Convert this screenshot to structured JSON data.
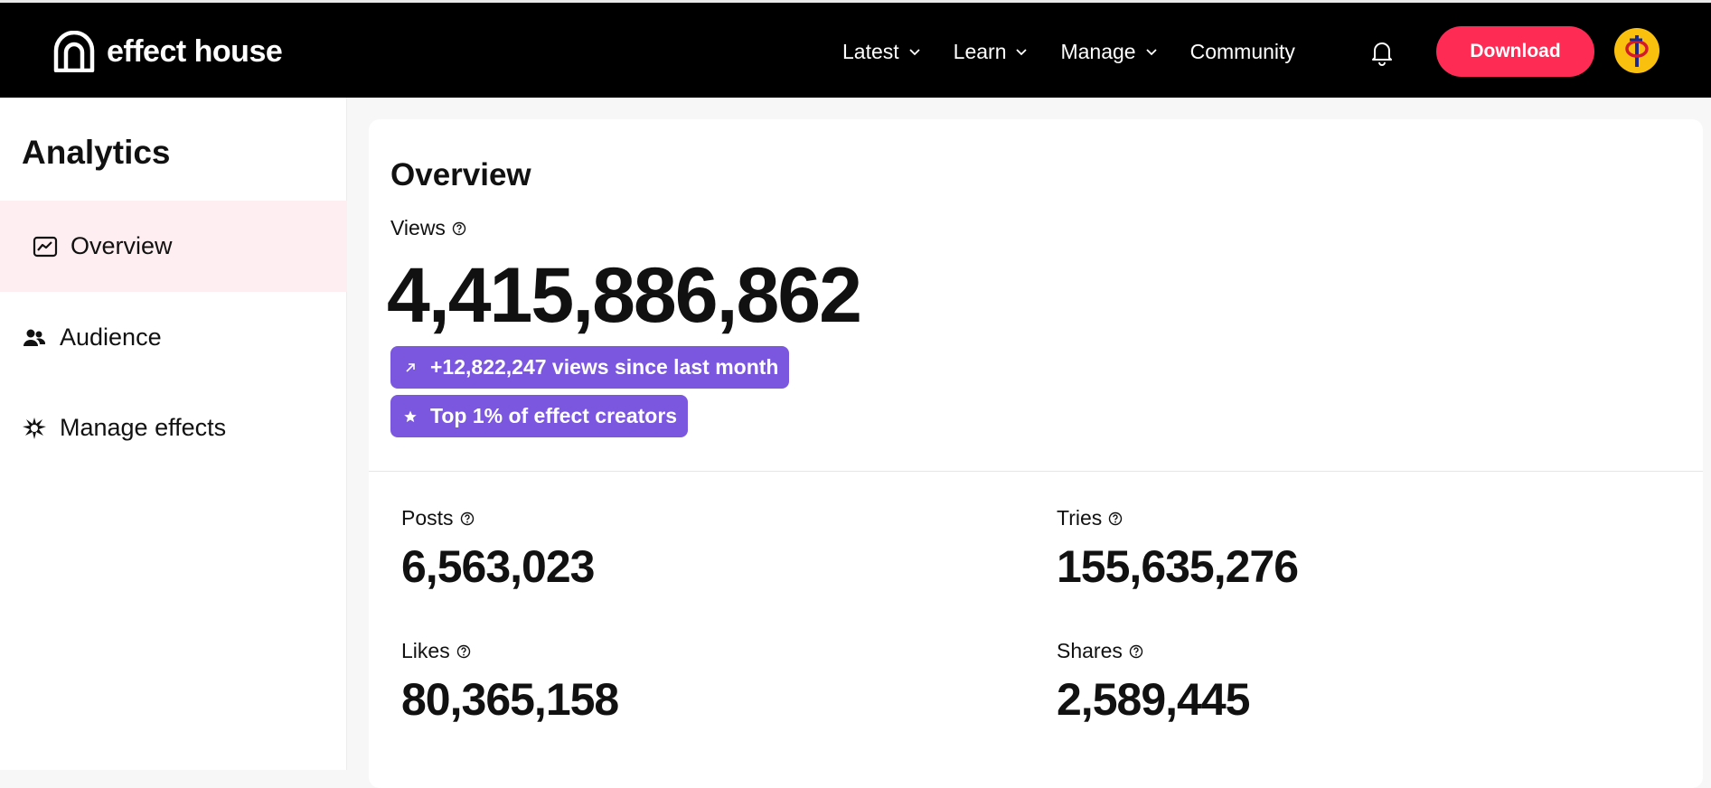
{
  "header": {
    "logo_text": "effect house",
    "nav": [
      {
        "label": "Latest",
        "has_dropdown": true
      },
      {
        "label": "Learn",
        "has_dropdown": true
      },
      {
        "label": "Manage",
        "has_dropdown": true
      },
      {
        "label": "Community",
        "has_dropdown": false
      }
    ],
    "download_label": "Download",
    "colors": {
      "download": "#fe2c55",
      "avatar_bg": "#f9c10e",
      "badge": "#7b57e0",
      "active_nav_bg": "#ffeef1"
    }
  },
  "sidebar": {
    "title": "Analytics",
    "items": [
      {
        "label": "Overview",
        "icon": "chart-icon",
        "active": true
      },
      {
        "label": "Audience",
        "icon": "people-icon",
        "active": false
      },
      {
        "label": "Manage effects",
        "icon": "effects-icon",
        "active": false
      }
    ]
  },
  "overview": {
    "title": "Overview",
    "views_label": "Views",
    "views_value": "4,415,886,862",
    "badges": [
      {
        "text": "+12,822,247 views since last month",
        "icon": "arrow-up-right-icon"
      },
      {
        "text": "Top 1% of effect creators",
        "icon": "star-icon"
      }
    ],
    "stats": [
      {
        "label": "Posts",
        "value": "6,563,023"
      },
      {
        "label": "Tries",
        "value": "155,635,276"
      },
      {
        "label": "Likes",
        "value": "80,365,158"
      },
      {
        "label": "Shares",
        "value": "2,589,445"
      }
    ]
  }
}
